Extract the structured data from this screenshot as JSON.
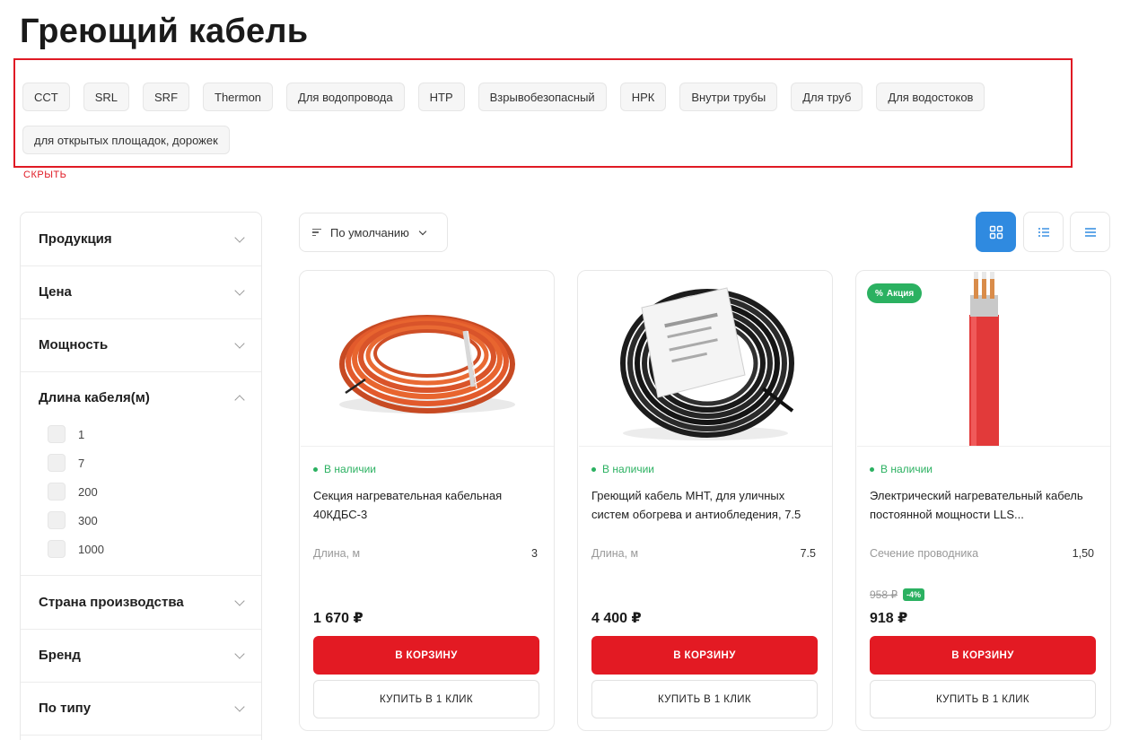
{
  "page": {
    "title": "Греющий кабель"
  },
  "tags": {
    "row1": [
      "CCT",
      "SRL",
      "SRF",
      "Thermon",
      "Для водопровода",
      "НТР",
      "Взрывобезопасный",
      "НРК",
      "Внутри трубы",
      "Для труб",
      "Для водостоков"
    ],
    "row2": [
      "для открытых площадок, дорожек"
    ],
    "hide_label": "СКРЫТЬ"
  },
  "filters": {
    "sections": [
      "Продукция",
      "Цена",
      "Мощность",
      "Длина кабеля(м)",
      "Страна производства",
      "Бренд",
      "По типу"
    ],
    "cable_length_options": [
      "1",
      "7",
      "200",
      "300",
      "1000"
    ]
  },
  "toolbar": {
    "sort_label": "По умолчанию"
  },
  "products": [
    {
      "stock": "В наличии",
      "title": "Секция нагревательная кабельная 40КДБС-3",
      "prop_name": "Длина, м",
      "prop_value": "3",
      "price": "1 670 ₽",
      "cart_label": "В КОРЗИНУ",
      "oneclick_label": "КУПИТЬ В 1 КЛИК"
    },
    {
      "stock": "В наличии",
      "title": "Греющий кабель МНТ, для уличных систем обогрева и антиобледения, 7.5",
      "prop_name": "Длина, м",
      "prop_value": "7.5",
      "price": "4 400 ₽",
      "cart_label": "В КОРЗИНУ",
      "oneclick_label": "КУПИТЬ В 1 КЛИК"
    },
    {
      "promo": "Акция",
      "stock": "В наличии",
      "title": "Электрический нагревательный кабель постоянной мощности LLS...",
      "prop_name": "Сечение проводника",
      "prop_value": "1,50",
      "old_price": "958 ₽",
      "discount": "-4%",
      "price": "918 ₽",
      "cart_label": "В КОРЗИНУ",
      "oneclick_label": "КУПИТЬ В 1 КЛИК"
    }
  ],
  "colors": {
    "accent_red": "#e31a23",
    "accent_blue": "#2f8ae0",
    "stock_green": "#2bb161"
  }
}
